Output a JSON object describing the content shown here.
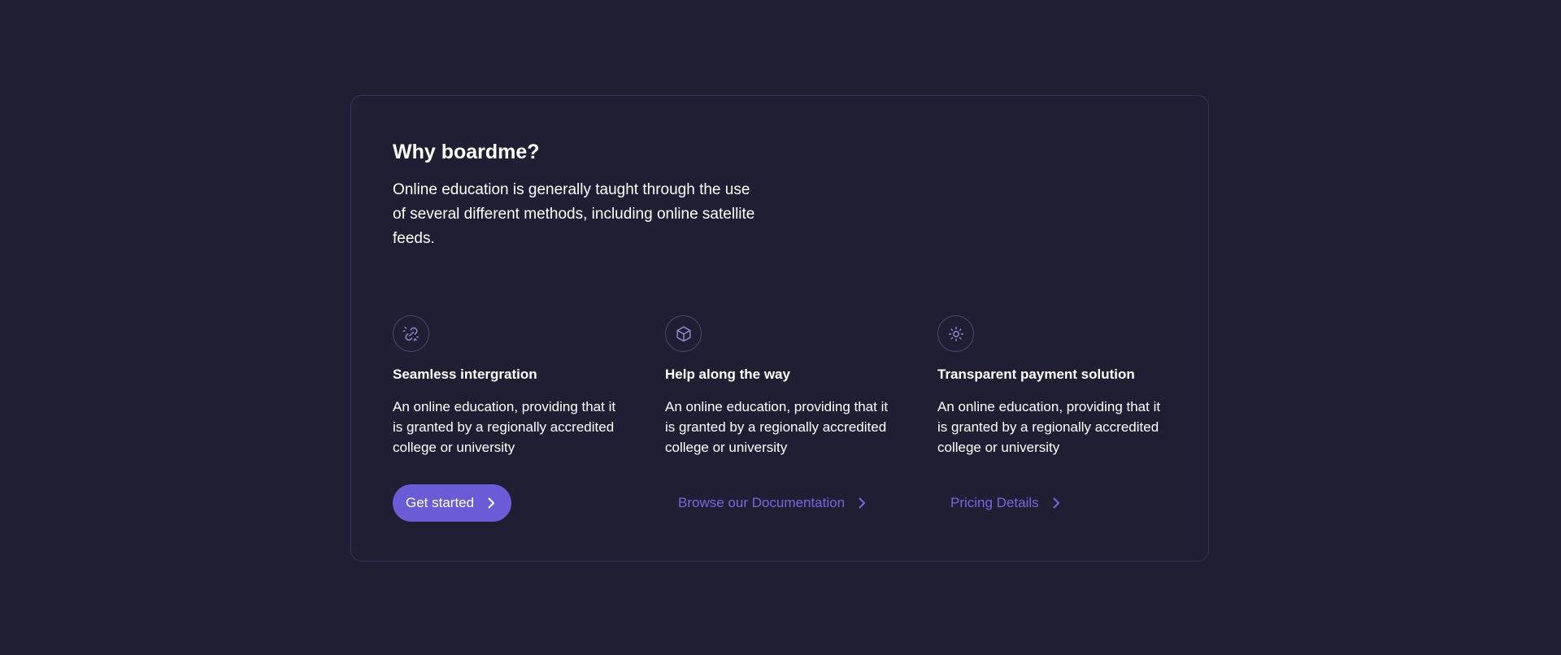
{
  "section": {
    "title": "Why boardme?",
    "description": "Online education is generally taught through the use of several different methods, including online satellite feeds."
  },
  "features": [
    {
      "icon": "link-icon",
      "title": "Seamless intergration",
      "description": "An online education, providing that it is granted by a regionally accredited college or university"
    },
    {
      "icon": "cube-icon",
      "title": "Help along the way",
      "description": "An online education, providing that it is granted by a regionally accredited college or university"
    },
    {
      "icon": "sun-icon",
      "title": "Transparent payment solution",
      "description": "An online education, providing that it is granted by a regionally accredited college or university"
    }
  ],
  "actions": {
    "get_started": "Get started",
    "documentation": "Browse our Documentation",
    "pricing": "Pricing Details"
  },
  "colors": {
    "background": "#201e33",
    "accent": "#6a5cd6",
    "link": "#7468e0",
    "border": "#35325a"
  }
}
